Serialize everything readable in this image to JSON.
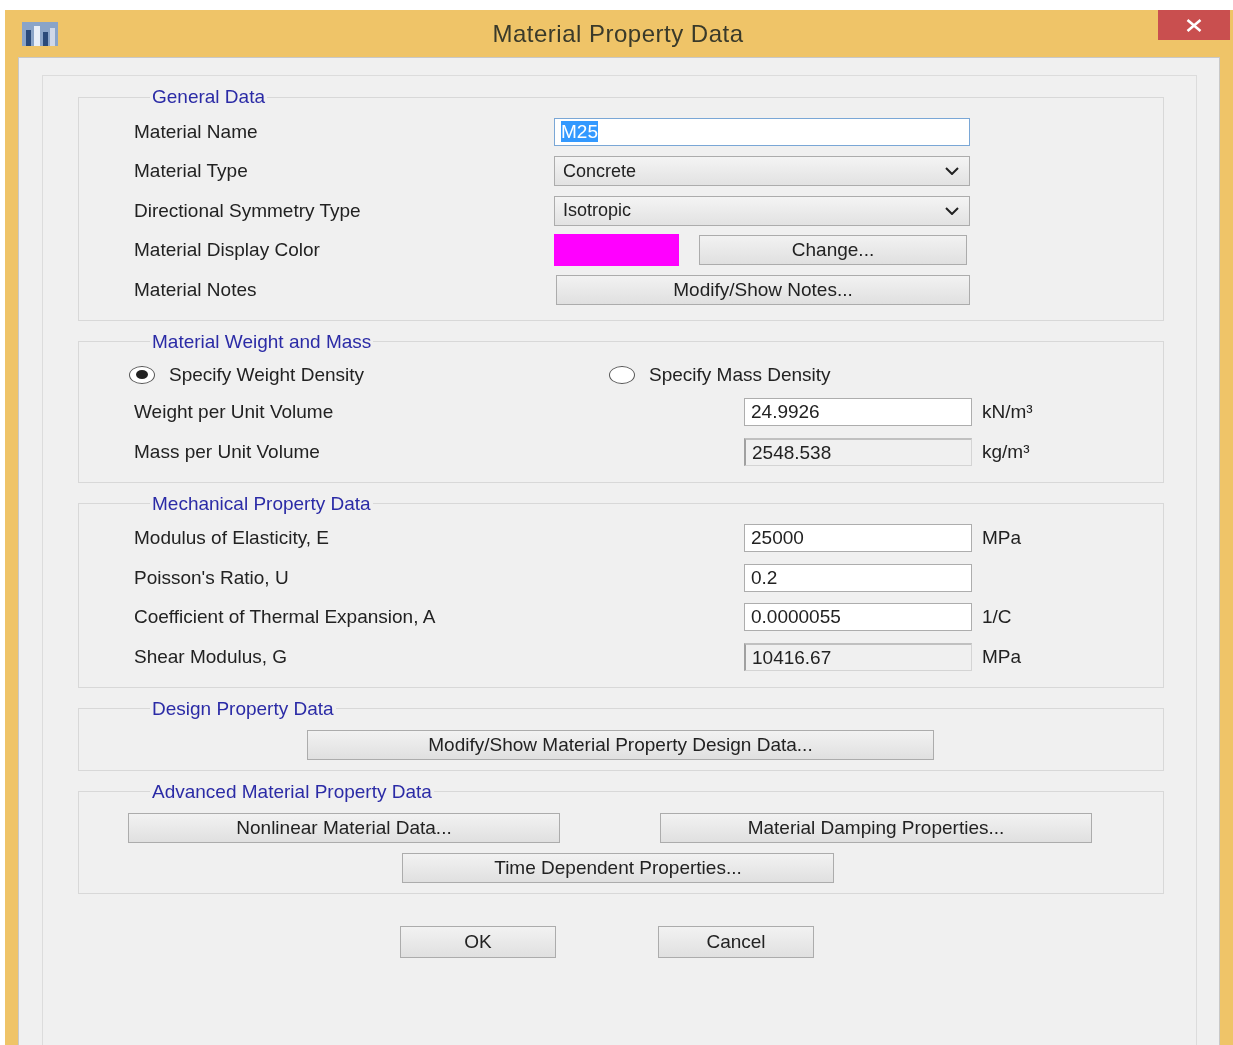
{
  "window": {
    "title": "Material Property Data"
  },
  "general": {
    "title": "General Data",
    "rows": [
      {
        "kind": "text",
        "label": "Material Name",
        "value": "M25",
        "selected": true
      },
      {
        "kind": "dropdown",
        "label": "Material Type",
        "value": "Concrete"
      },
      {
        "kind": "dropdown",
        "label": "Directional Symmetry Type",
        "value": "Isotropic"
      },
      {
        "kind": "color",
        "label": "Material Display Color",
        "color": "#ff00ff",
        "button": "Change..."
      },
      {
        "kind": "button",
        "label": "Material Notes",
        "button": "Modify/Show Notes..."
      }
    ]
  },
  "weight": {
    "title": "Material Weight and Mass",
    "radios": [
      {
        "label": "Specify Weight Density",
        "selected": true
      },
      {
        "label": "Specify Mass Density",
        "selected": false
      }
    ],
    "fields": [
      {
        "label": "Weight per Unit Volume",
        "value": "24.9926",
        "unit": "kN/m³",
        "disabled": false
      },
      {
        "label": "Mass per Unit Volume",
        "value": "2548.538",
        "unit": "kg/m³",
        "disabled": true
      }
    ]
  },
  "mechanical": {
    "title": "Mechanical Property Data",
    "fields": [
      {
        "label": "Modulus of Elasticity,  E",
        "value": "25000",
        "unit": "MPa",
        "disabled": false
      },
      {
        "label": "Poisson's Ratio,  U",
        "value": "0.2",
        "disabled": false
      },
      {
        "label": "Coefficient of Thermal Expansion,  A",
        "value": "0.0000055",
        "unit": "1/C",
        "disabled": false
      },
      {
        "label": "Shear Modulus,  G",
        "value": "10416.67",
        "unit": "MPa",
        "disabled": true
      }
    ]
  },
  "design": {
    "title": "Design Property Data",
    "button": "Modify/Show Material Property Design Data..."
  },
  "advanced": {
    "title": "Advanced Material Property Data",
    "buttons": [
      "Nonlinear Material Data...",
      "Material Damping Properties...",
      "Time Dependent Properties..."
    ]
  },
  "buttons": [
    "OK",
    "Cancel"
  ]
}
